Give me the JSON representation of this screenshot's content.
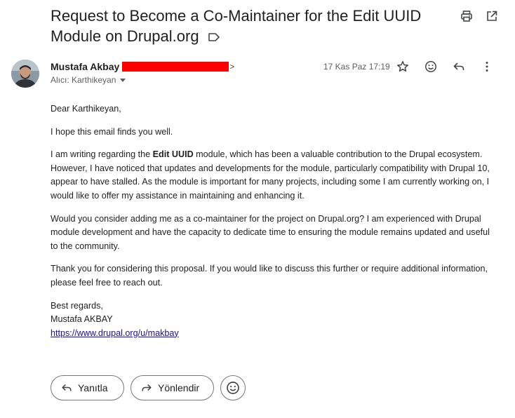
{
  "email": {
    "subject": "Request to Become a Co-Maintainer for the Edit UUID Module on Drupal.org",
    "sender_name": "Mustafa Akbay",
    "recipient_label": "Alıcı: Karthikeyan",
    "date": "17 Kas Paz 17:19"
  },
  "body": {
    "greeting": "Dear Karthikeyan,",
    "p1": "I hope this email finds you well.",
    "p2_a": "I am writing regarding the ",
    "p2_bold": "Edit UUID",
    "p2_b": " module, which has been a valuable contribution to the Drupal ecosystem. However, I have noticed that updates and developments for the module, particularly compatibility with Drupal 10, appear to have stalled. As the module is important for many projects, including some I am currently working on, I would like to offer my assistance in maintaining and enhancing it.",
    "p3": "Would you consider adding me as a co-maintainer for the project on Drupal.org? I am experienced with Drupal module development and have the capacity to dedicate time to ensuring the module remains updated and useful to the community.",
    "p4": "Thank you for considering this proposal. If you would like to discuss this further or require additional information, please feel free to reach out.",
    "closing": "Best regards,",
    "signature_name": "Mustafa AKBAY",
    "signature_link": "https://www.drupal.org/u/makbay"
  },
  "actions": {
    "reply_label": "Yanıtla",
    "forward_label": "Yönlendir"
  },
  "icons": {
    "print": "print-icon",
    "open_new": "open-in-new-window-icon",
    "label": "label-tag-icon",
    "star": "star-icon",
    "emoji": "emoji-reaction-icon",
    "reply": "reply-icon",
    "more": "more-vert-icon",
    "forward": "forward-icon"
  },
  "colors": {
    "link": "#1a0dab",
    "redaction": "#ff0000"
  }
}
